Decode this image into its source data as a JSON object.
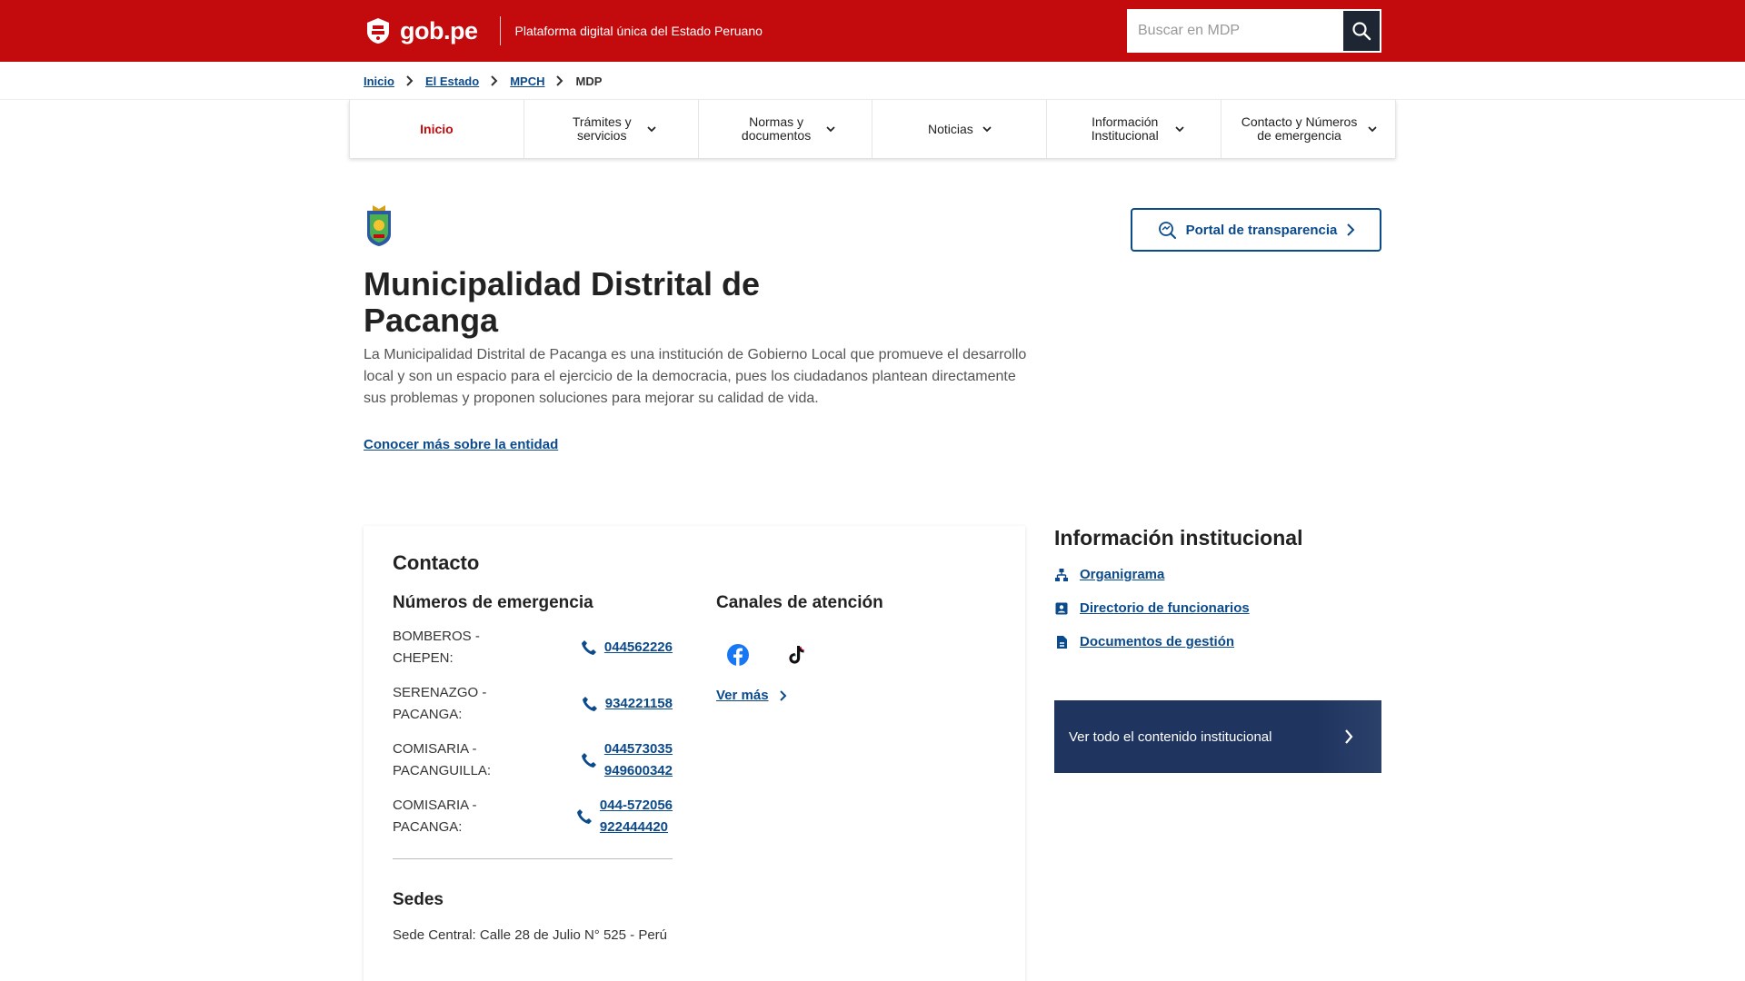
{
  "header": {
    "logo_text": "gob.pe",
    "tagline": "Plataforma digital única del Estado Peruano",
    "search_placeholder": "Buscar en MDP",
    "colors": {
      "brand_red": "#c30a0c",
      "link_blue": "#0b4a8b",
      "dark_navy": "#1f3560"
    }
  },
  "breadcrumb": {
    "items": [
      "Inicio",
      "El Estado",
      "MPCH"
    ],
    "current": "MDP"
  },
  "nav": {
    "items": [
      {
        "label": "Inicio",
        "active": true
      },
      {
        "label": "Trámites y servicios",
        "active": false
      },
      {
        "label": "Normas y documentos",
        "active": false
      },
      {
        "label": "Noticias",
        "active": false
      },
      {
        "label": "Información Institucional",
        "active": false
      },
      {
        "label": "Contacto y Números de emergencia",
        "active": false
      }
    ]
  },
  "hero": {
    "title": "Municipalidad Distrital de Pacanga",
    "description": "La Municipalidad Distrital de Pacanga es una institución de Gobierno Local que promueve el desarrollo local y son un espacio para el ejercicio de la democracia, pues los ciudadanos plantean directamente sus problemas y proponen soluciones para mejorar su calidad de vida.",
    "more_link": "Conocer más sobre la entidad",
    "portal_button": "Portal de transparencia"
  },
  "contact": {
    "title": "Contacto",
    "emergency_title": "Números de emergencia",
    "emergency": [
      {
        "label": "BOMBEROS - CHEPEN:",
        "numbers": [
          "044562226"
        ]
      },
      {
        "label": "SERENAZGO - PACANGA:",
        "numbers": [
          "934221158"
        ]
      },
      {
        "label": "COMISARIA - PACANGUILLA:",
        "numbers": [
          "044573035",
          "949600342"
        ]
      },
      {
        "label": "COMISARIA - PACANGA:",
        "numbers": [
          "044-572056",
          "922444420"
        ]
      }
    ],
    "channels_title": "Canales de atención",
    "channels": [
      "facebook-icon",
      "tiktok-icon"
    ],
    "ver_mas": "Ver más",
    "sedes_title": "Sedes",
    "sede_central": "Sede Central: Calle 28 de Julio N° 525 - Perú"
  },
  "institutional": {
    "title": "Información institucional",
    "links": [
      "Organigrama",
      "Directorio de funcionarios",
      "Documentos de gestión"
    ],
    "view_all": "Ver todo el contenido institucional"
  }
}
